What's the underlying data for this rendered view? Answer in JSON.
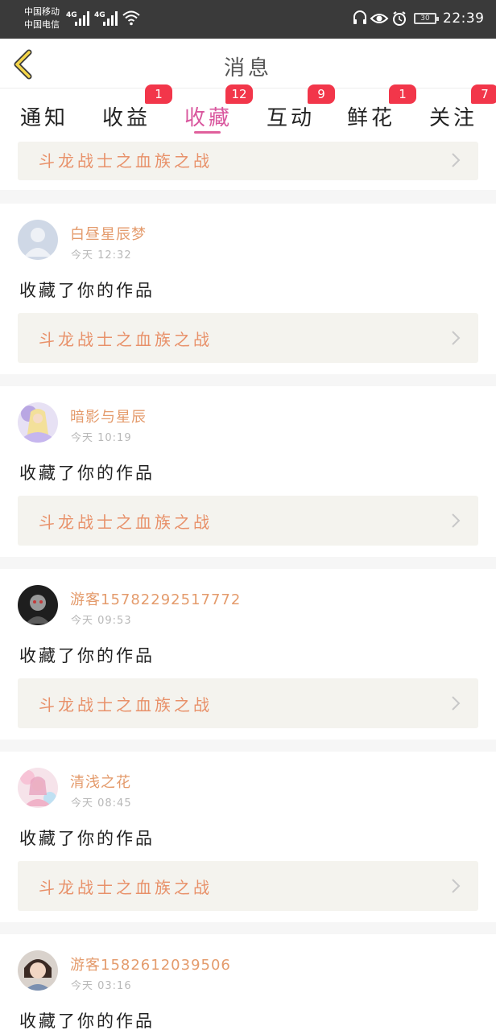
{
  "status_bar": {
    "carrier1": "中国移动",
    "carrier2": "中国电信",
    "net1": "4G",
    "net2": "4G",
    "battery": "30",
    "time": "22:39"
  },
  "header": {
    "title": "消息"
  },
  "tabs": [
    {
      "label": "通知",
      "badge": ""
    },
    {
      "label": "收益",
      "badge": "1"
    },
    {
      "label": "收藏",
      "badge": "12"
    },
    {
      "label": "互动",
      "badge": "9"
    },
    {
      "label": "鲜花",
      "badge": "1"
    },
    {
      "label": "关注",
      "badge": "7"
    }
  ],
  "active_tab": "收藏",
  "items": [
    {
      "work": "斗龙战士之血族之战"
    },
    {
      "name": "白昼星辰梦",
      "time": "今天 12:32",
      "action": "收藏了你的作品",
      "work": "斗龙战士之血族之战"
    },
    {
      "name": "暗影与星辰",
      "time": "今天 10:19",
      "action": "收藏了你的作品",
      "work": "斗龙战士之血族之战"
    },
    {
      "name": "游客15782292517772",
      "time": "今天 09:53",
      "action": "收藏了你的作品",
      "work": "斗龙战士之血族之战"
    },
    {
      "name": "清浅之花",
      "time": "今天 08:45",
      "action": "收藏了你的作品",
      "work": "斗龙战士之血族之战"
    },
    {
      "name": "游客1582612039506",
      "time": "今天 03:16",
      "action": "收藏了你的作品"
    }
  ]
}
